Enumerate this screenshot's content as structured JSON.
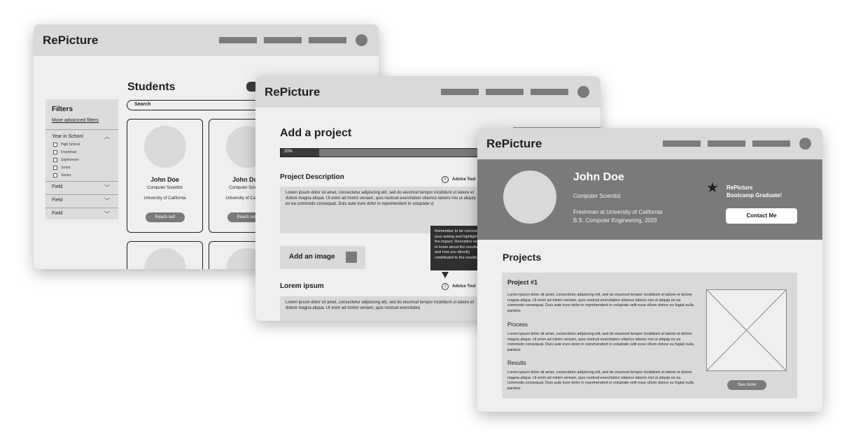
{
  "brand": "RePicture",
  "students_page": {
    "title": "Students",
    "search_label": "Search",
    "filters": {
      "title": "Filters",
      "advanced_link": "More advanced filters",
      "year_label": "Year in School",
      "year_options": [
        "High School",
        "Freshman",
        "Sophomore",
        "Junior",
        "Senior"
      ],
      "field_labels": [
        "Field",
        "Field",
        "Field"
      ]
    },
    "cards": [
      {
        "name": "John Doe",
        "role": "Computer Scientist",
        "school": "University of California",
        "button": "Reach out!"
      },
      {
        "name": "John Doe",
        "role": "Computer Scientist",
        "school": "University of California",
        "button": "Reach out!"
      }
    ]
  },
  "add_project_page": {
    "title": "Add a project",
    "progress_label": "20%",
    "progress_value": 0.2,
    "description_heading": "Project Description",
    "advice_label": "Advice Tool",
    "description_text": "Lorem ipsum dolor sit amet, consectetur adipiscing elit, sed do eiusmod tempor incididunt ut labore et dolore magna aliqua. Ut enim ad minim veniam, quis nostrud exercitation ullamco laboris nisi ut aliquip ex ea commodo consequat. Duis aute irure dolor in reprehenderit in voluptate v|",
    "add_image_label": "Add an image",
    "tooltip_text": "Remember to be concise in your writing and highlight the impact. Recruiters want to know about the results and how you directly contributed to the results.",
    "second_heading": "Lorem ipsum",
    "second_text": "Lorem ipsum dolor sit amet, consectetur adipiscing elit, sed do eiusmod tempor incididunt ut labore et dolore magna aliqua. Ut enim ad minim veniam, quis nostrud exercitatio|"
  },
  "profile_page": {
    "name": "John Doe",
    "role": "Computer Scientist",
    "education_line1": "Freshman at University of California",
    "education_line2": "B.S. Computer Engineering, 2023",
    "badge_line1": "RePicture",
    "badge_line2": "Bootcamp Graduate!",
    "contact_button": "Contact Me",
    "projects_heading": "Projects",
    "project": {
      "title": "Project #1",
      "intro": "Lorem ipsum dolor sit amet, consectetur adipiscing elit, sed do eiusmod tempor incididunt ut labore et dolore magna aliqua. Ut enim ad minim veniam, quis nostrud exercitation ullamco laboris nisi ut aliquip ex ea commodo consequat. Duis aute irure dolor in reprehenderit in voluptate velit esse cillum dolore eu fugiat nulla pariatur.",
      "process_heading": "Process",
      "process_text": "Lorem ipsum dolor sit amet, consectetur adipiscing elit, sed do eiusmod tempor incididunt ut labore et dolore magna aliqua. Ut enim ad minim veniam, quis nostrud exercitation ullamco laboris nisi ut aliquip ex ea commodo consequat. Duis aute irure dolor in reprehenderit in voluptate velit esse cillum dolore eu fugiat nulla pariatur.",
      "results_heading": "Results",
      "results_text": "Lorem ipsum dolor sit amet, consectetur adipiscing elit, sed do eiusmod tempor incididunt ut labore et dolore magna aliqua. Ut enim ad minim veniam, quis nostrud exercitation ullamco laboris nisi ut aliquip ex ea commodo consequat. Duis aute irure dolor in reprehenderit in voluptate velit esse cillum dolore eu fugiat nulla pariatur.",
      "see_more": "See more"
    }
  },
  "colors": {
    "header": "#d9d9d9",
    "page": "#efefef",
    "dark_gray": "#7a7a7a",
    "tooltip": "#2f2f2f"
  }
}
